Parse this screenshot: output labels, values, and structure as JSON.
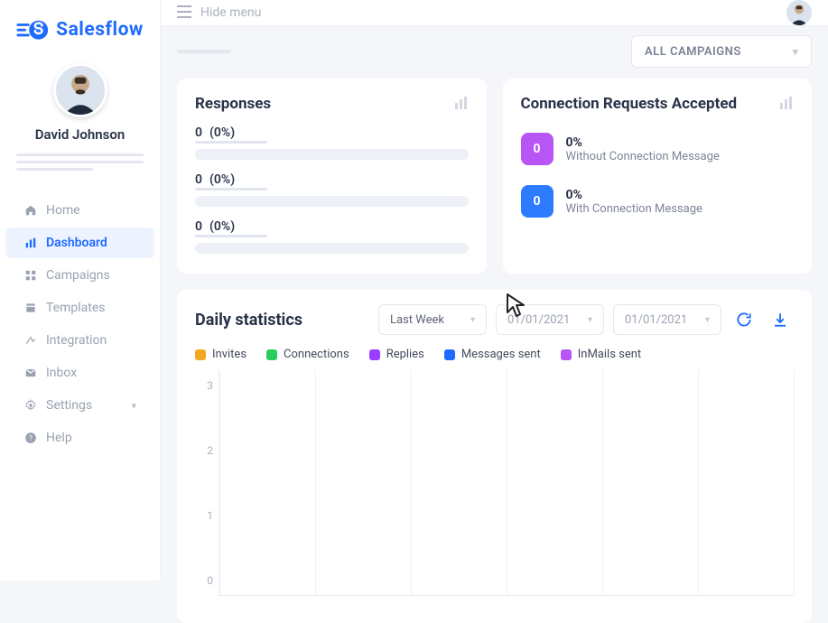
{
  "brand": {
    "name": "Salesflow"
  },
  "user": {
    "name": "David Johnson"
  },
  "top": {
    "hide_menu": "Hide menu",
    "campaign_filter": "ALL CAMPAIGNS"
  },
  "nav": {
    "home": "Home",
    "dashboard": "Dashboard",
    "campaigns": "Campaigns",
    "templates": "Templates",
    "integration": "Integration",
    "inbox": "Inbox",
    "settings": "Settings",
    "help": "Help"
  },
  "responses": {
    "title": "Responses",
    "rows": [
      {
        "count": "0",
        "pct": "(0%)"
      },
      {
        "count": "0",
        "pct": "(0%)"
      },
      {
        "count": "0",
        "pct": "(0%)"
      }
    ]
  },
  "conn": {
    "title": "Connection Requests Accepted",
    "without": {
      "badge": "0",
      "pct": "0%",
      "desc": "Without Connection Message"
    },
    "with": {
      "badge": "0",
      "pct": "0%",
      "desc": "With Connection Message"
    }
  },
  "stats": {
    "title": "Daily statistics",
    "range": "Last Week",
    "date1": "01/01/2021",
    "date2": "01/01/2021",
    "legend": {
      "invites": {
        "label": "Invites",
        "color": "#f5a623"
      },
      "connections": {
        "label": "Connections",
        "color": "#29cc5f"
      },
      "replies": {
        "label": "Replies",
        "color": "#9b3dff"
      },
      "messages": {
        "label": "Messages sent",
        "color": "#1e6bff"
      },
      "inmails": {
        "label": "InMails sent",
        "color": "#b755f5"
      }
    }
  },
  "chart_data": {
    "type": "line",
    "title": "Daily statistics",
    "xlabel": "",
    "ylabel": "",
    "ylim": [
      0,
      3
    ],
    "yticks": [
      0,
      1,
      2,
      3
    ],
    "categories": [
      "",
      "",
      "",
      "",
      "",
      "",
      ""
    ],
    "series": [
      {
        "name": "Invites",
        "color": "#f5a623",
        "values": [
          0,
          0,
          0,
          0,
          0,
          0,
          0
        ]
      },
      {
        "name": "Connections",
        "color": "#29cc5f",
        "values": [
          0,
          0,
          0,
          0,
          0,
          0,
          0
        ]
      },
      {
        "name": "Replies",
        "color": "#9b3dff",
        "values": [
          0,
          0,
          0,
          0,
          0,
          0,
          0
        ]
      },
      {
        "name": "Messages sent",
        "color": "#1e6bff",
        "values": [
          0,
          0,
          0,
          0,
          0,
          0,
          0
        ]
      },
      {
        "name": "InMails sent",
        "color": "#b755f5",
        "values": [
          0,
          0,
          0,
          0,
          0,
          0,
          0
        ]
      }
    ]
  }
}
